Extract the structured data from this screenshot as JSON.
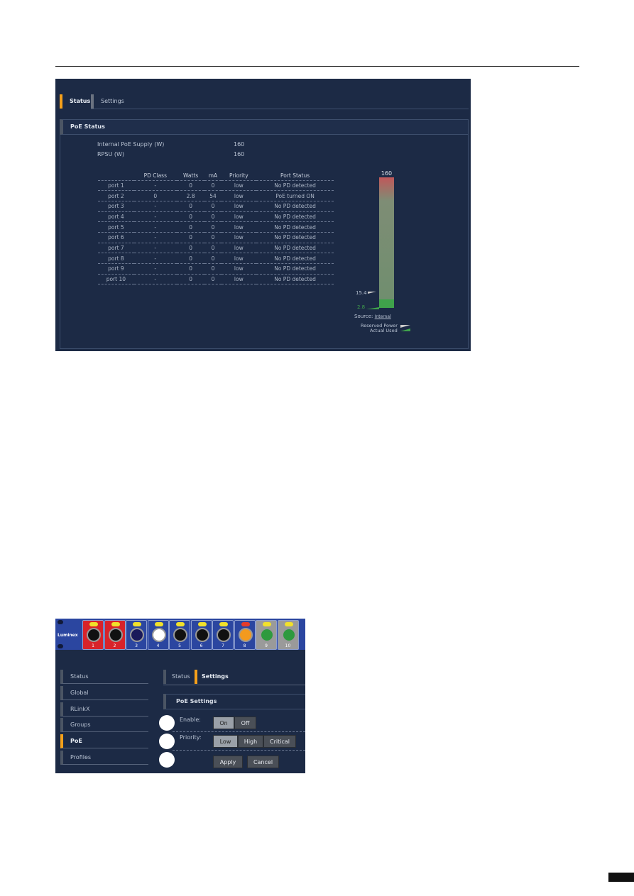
{
  "status_screen": {
    "tabs": [
      {
        "label": "Status",
        "active": true
      },
      {
        "label": "Settings",
        "active": false
      }
    ],
    "section_title": "PoE Status",
    "supply": [
      {
        "label": "Internal PoE Supply (W)",
        "value": "160"
      },
      {
        "label": "RPSU (W)",
        "value": "160"
      }
    ],
    "table": {
      "headers": [
        "",
        "PD Class",
        "Watts",
        "mA",
        "Priority",
        "Port Status"
      ],
      "rows": [
        [
          "port 1",
          "-",
          "0",
          "0",
          "low",
          "No PD detected"
        ],
        [
          "port 2",
          "0",
          "2.8",
          "54",
          "low",
          "PoE turned ON"
        ],
        [
          "port 3",
          "-",
          "0",
          "0",
          "low",
          "No PD detected"
        ],
        [
          "port 4",
          "-",
          "0",
          "0",
          "low",
          "No PD detected"
        ],
        [
          "port 5",
          "-",
          "0",
          "0",
          "low",
          "No PD detected"
        ],
        [
          "port 6",
          "-",
          "0",
          "0",
          "low",
          "No PD detected"
        ],
        [
          "port 7",
          "-",
          "0",
          "0",
          "low",
          "No PD detected"
        ],
        [
          "port 8",
          "-",
          "0",
          "0",
          "low",
          "No PD detected"
        ],
        [
          "port 9",
          "-",
          "0",
          "0",
          "low",
          "No PD detected"
        ],
        [
          "port 10",
          "-",
          "0",
          "0",
          "low",
          "No PD detected"
        ]
      ]
    },
    "gauge": {
      "max": "160",
      "reserved": "15.4",
      "actual": "2.8",
      "source_label": "Source:",
      "source_value": "Internal",
      "legend_reserved": "Reserved Power",
      "legend_actual": "Actual Used"
    }
  },
  "settings_screen": {
    "brand": "Luminex",
    "ports": [
      {
        "n": "1",
        "bg": "#d8232a",
        "led": "#f2e12a",
        "jack": "#111"
      },
      {
        "n": "2",
        "bg": "#d8232a",
        "led": "#f2e12a",
        "jack": "#111"
      },
      {
        "n": "3",
        "bg": "#2b46a0",
        "led": "#f2e12a",
        "jack": "#1a1a5a"
      },
      {
        "n": "4",
        "bg": "#2b46a0",
        "led": "#f2e12a",
        "jack": "#ffffff"
      },
      {
        "n": "5",
        "bg": "#2b46a0",
        "led": "#f2e12a",
        "jack": "#111"
      },
      {
        "n": "6",
        "bg": "#2b46a0",
        "led": "#f2e12a",
        "jack": "#111"
      },
      {
        "n": "7",
        "bg": "#2b46a0",
        "led": "#f2e12a",
        "jack": "#111"
      },
      {
        "n": "8",
        "bg": "#2b46a0",
        "led": "#e53b2a",
        "jack": "#f39a1e"
      },
      {
        "n": "9",
        "bg": "#9a9a9a",
        "led": "#f2e12a",
        "jack": "#2e9a3e"
      },
      {
        "n": "10",
        "bg": "#9a9a9a",
        "led": "#f2e12a",
        "jack": "#2e9a3e"
      }
    ],
    "sidebar": [
      "Status",
      "Global",
      "RLinkX",
      "Groups",
      "PoE",
      "Profiles"
    ],
    "sidebar_active": "PoE",
    "tabs": [
      {
        "label": "Status",
        "active": false
      },
      {
        "label": "Settings",
        "active": true
      }
    ],
    "section_title": "PoE Settings",
    "enable_label": "Enable:",
    "enable_options": [
      "On",
      "Off"
    ],
    "priority_label": "Priority:",
    "priority_options": [
      "Low",
      "High",
      "Critical"
    ],
    "apply": "Apply",
    "cancel": "Cancel"
  },
  "colors": {
    "accent": "#f5a01a",
    "panel": "#1c2a45"
  }
}
